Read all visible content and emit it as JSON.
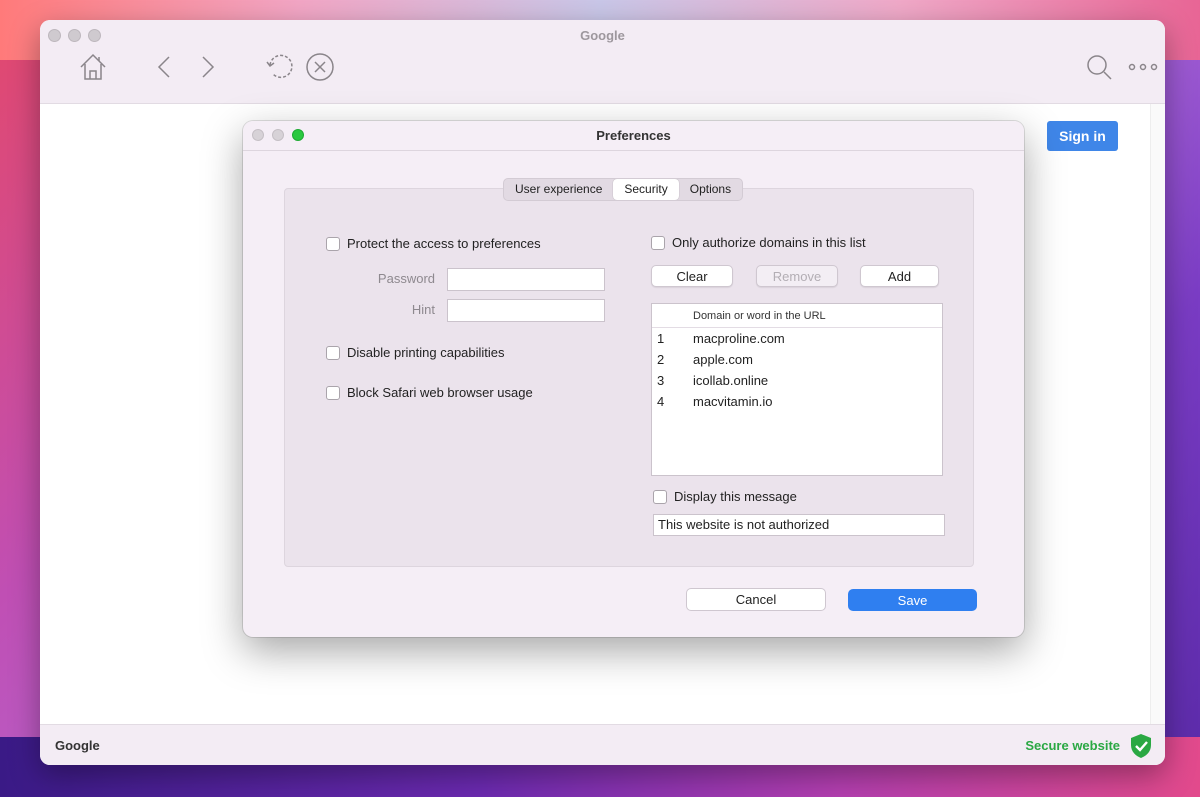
{
  "browser": {
    "title": "Google",
    "sign_in_label": "Sign in",
    "status_left": "Google",
    "status_right": "Secure website"
  },
  "icons": {
    "home": "home-icon",
    "back": "chevron-left-icon",
    "forward": "chevron-right-icon",
    "reload": "reload-icon",
    "stop": "stop-icon",
    "search": "search-icon",
    "more": "more-icon",
    "shield": "shield-check-icon"
  },
  "colors": {
    "accent": "#2f7ff0",
    "secure": "#2aa843"
  },
  "dialog": {
    "title": "Preferences",
    "tabs": [
      {
        "label": "User experience",
        "active": false
      },
      {
        "label": "Security",
        "active": true
      },
      {
        "label": "Options",
        "active": false
      }
    ],
    "left": {
      "protect_label": "Protect the access to preferences",
      "password_label": "Password",
      "password_value": "",
      "hint_label": "Hint",
      "hint_value": "",
      "disable_printing_label": "Disable printing capabilities",
      "block_safari_label": "Block Safari web browser usage"
    },
    "right": {
      "only_authorize_label": "Only authorize domains in this list",
      "clear_label": "Clear",
      "remove_label": "Remove",
      "add_label": "Add",
      "table_header": "Domain or word in the URL",
      "domains": [
        {
          "num": "1",
          "domain": "macproline.com"
        },
        {
          "num": "2",
          "domain": "apple.com"
        },
        {
          "num": "3",
          "domain": "icollab.online"
        },
        {
          "num": "4",
          "domain": "macvitamin.io"
        }
      ],
      "display_message_label": "Display this message",
      "message_value": "This website is not authorized"
    },
    "cancel_label": "Cancel",
    "save_label": "Save"
  }
}
